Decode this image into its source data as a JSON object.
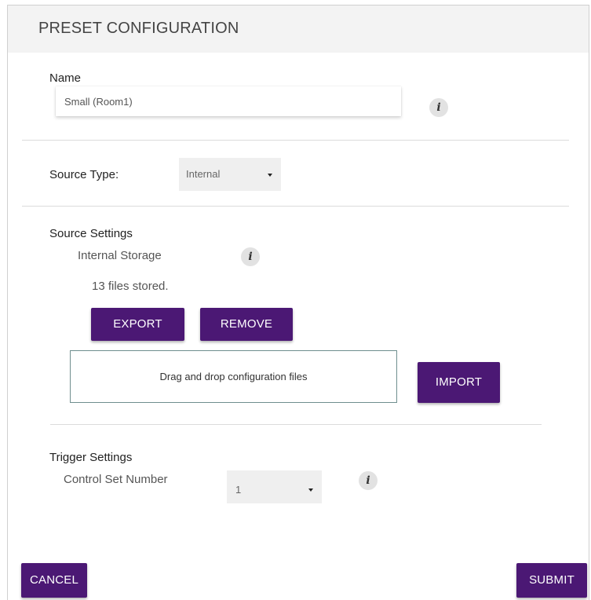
{
  "header": {
    "title": "PRESET CONFIGURATION"
  },
  "name_section": {
    "label": "Name",
    "value": "Small (Room1)"
  },
  "source_type": {
    "label": "Source Type:",
    "selected": "Internal"
  },
  "source_settings": {
    "label": "Source Settings",
    "storage_label": "Internal Storage",
    "files_text": "13 files stored.",
    "export_label": "EXPORT",
    "remove_label": "REMOVE",
    "dropzone_text": "Drag and drop configuration files",
    "import_label": "IMPORT"
  },
  "trigger_settings": {
    "label": "Trigger Settings",
    "control_set_label": "Control Set Number",
    "control_set_value": "1"
  },
  "footer": {
    "cancel_label": "CANCEL",
    "submit_label": "SUBMIT"
  },
  "icons": {
    "info": "info-icon",
    "dropdown": "caret-down-icon"
  },
  "colors": {
    "primary_button": "#4b1874",
    "header_bg": "#f3f3f3",
    "select_bg": "#efefef"
  }
}
